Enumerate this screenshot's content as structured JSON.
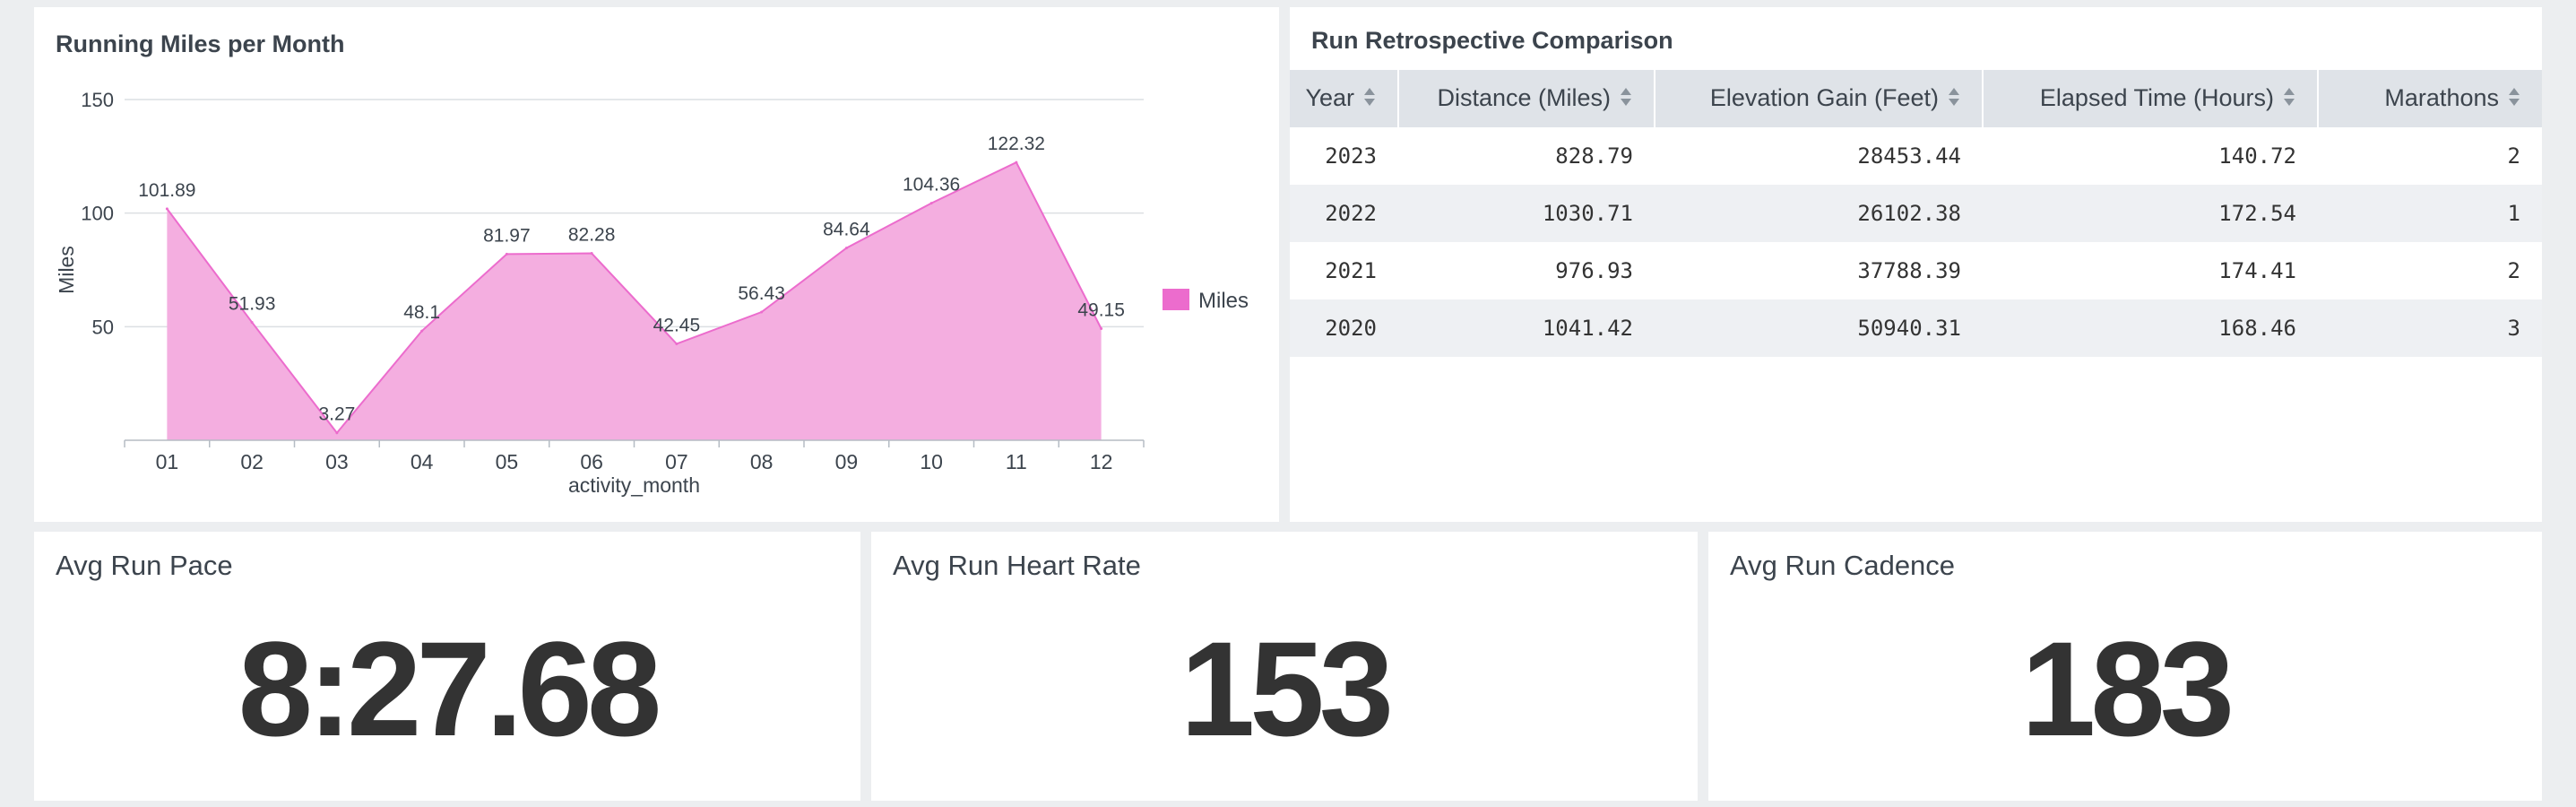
{
  "chart_panel": {
    "title": "Running Miles per Month"
  },
  "chart_data": {
    "type": "area",
    "title": "Running Miles per Month",
    "xlabel": "activity_month",
    "ylabel": "Miles",
    "categories": [
      "01",
      "02",
      "03",
      "04",
      "05",
      "06",
      "07",
      "08",
      "09",
      "10",
      "11",
      "12"
    ],
    "series": [
      {
        "name": "Miles",
        "values": [
          101.89,
          51.93,
          3.27,
          48.1,
          81.97,
          82.28,
          42.45,
          56.43,
          84.64,
          104.36,
          122.32,
          49.15
        ]
      }
    ],
    "data_labels": [
      "101.89",
      "51.93",
      "3.27",
      "48.1",
      "81.97",
      "82.28",
      "42.45",
      "56.43",
      "84.64",
      "104.36",
      "122.32",
      "49.15"
    ],
    "yticks": [
      "50",
      "100",
      "150"
    ],
    "ylim": [
      0,
      150
    ],
    "grid": true,
    "legend": "right",
    "color": "#f4aee0",
    "line_color": "#ec6ccd"
  },
  "table_panel": {
    "title": "Run Retrospective Comparison",
    "columns": [
      "Year",
      "Distance (Miles)",
      "Elevation Gain (Feet)",
      "Elapsed Time (Hours)",
      "Marathons"
    ],
    "rows": [
      [
        "2023",
        "828.79",
        "28453.44",
        "140.72",
        "2"
      ],
      [
        "2022",
        "1030.71",
        "26102.38",
        "172.54",
        "1"
      ],
      [
        "2021",
        "976.93",
        "37788.39",
        "174.41",
        "2"
      ],
      [
        "2020",
        "1041.42",
        "50940.31",
        "168.46",
        "3"
      ]
    ]
  },
  "kpis": {
    "pace": {
      "title": "Avg Run Pace",
      "value": "8:27.68"
    },
    "heart_rate": {
      "title": "Avg Run Heart Rate",
      "value": "153"
    },
    "cadence": {
      "title": "Avg Run Cadence",
      "value": "183"
    }
  },
  "icons": {
    "sort": "sort-icon",
    "legend_swatch": "legend-swatch"
  }
}
